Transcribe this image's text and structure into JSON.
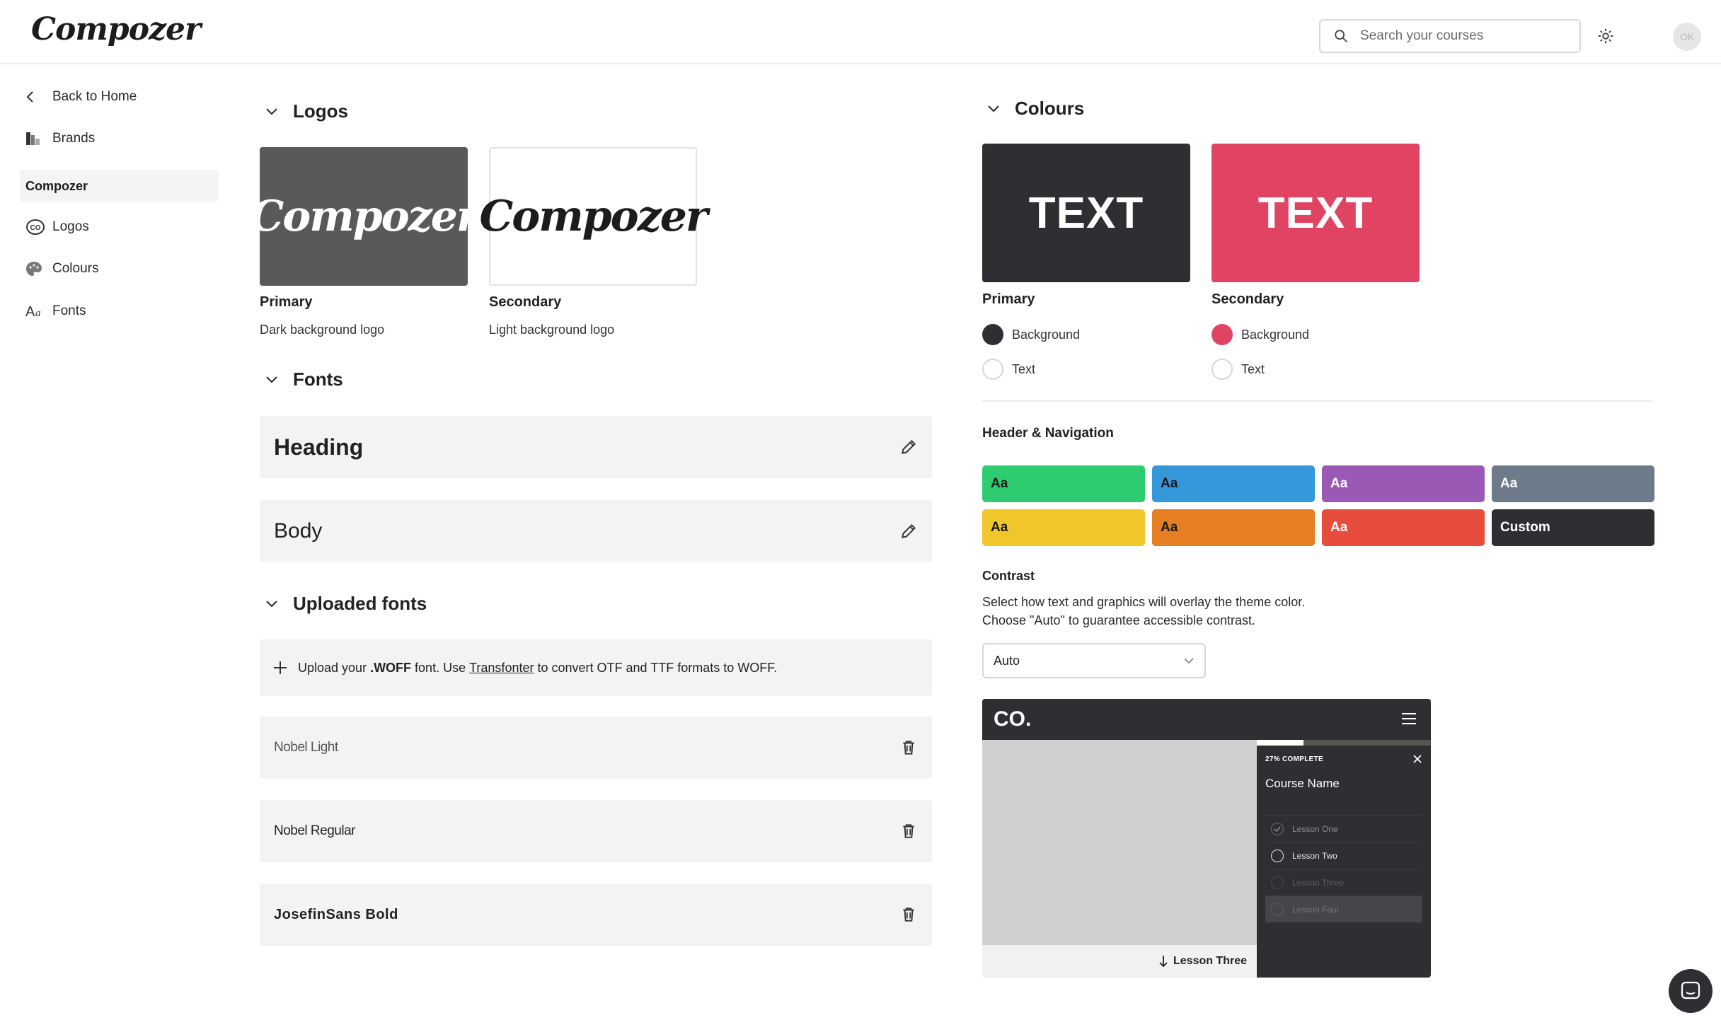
{
  "header": {
    "logo": "Compozer",
    "search_placeholder": "Search your courses",
    "avatar_initials": "OK",
    "icons": {
      "search": "search-icon",
      "settings": "gear-icon"
    }
  },
  "sidebar": {
    "back_label": "Back to Home",
    "brands_label": "Brands",
    "active_brand": "Compozer",
    "items": [
      {
        "label": "Logos",
        "icon": "co-badge-icon"
      },
      {
        "label": "Colours",
        "icon": "palette-icon"
      },
      {
        "label": "Fonts",
        "icon": "font-aa-icon"
      }
    ]
  },
  "logos": {
    "title": "Logos",
    "cards": [
      {
        "logo_text": "Compozer",
        "title": "Primary",
        "subtitle": "Dark background logo"
      },
      {
        "logo_text": "Compozer",
        "title": "Secondary",
        "subtitle": "Light background logo"
      }
    ]
  },
  "fonts": {
    "title": "Fonts",
    "rows": [
      {
        "label": "Heading"
      },
      {
        "label": "Body"
      }
    ]
  },
  "uploaded_fonts": {
    "title": "Uploaded fonts",
    "upload": {
      "prefix": "Upload your ",
      "format": ".WOFF",
      "middle": " font. Use ",
      "link": "Transfonter",
      "suffix": " to convert OTF and TTF formats to WOFF."
    },
    "items": [
      {
        "name": "Nobel Light"
      },
      {
        "name": "Nobel Regular"
      },
      {
        "name": "JosefinSans Bold"
      }
    ]
  },
  "colours": {
    "title": "Colours",
    "swatches": [
      {
        "text": "TEXT",
        "title": "Primary",
        "bg_label": "Background",
        "text_label": "Text",
        "bg_color": "#2e2f33",
        "text_color": "#ffffff"
      },
      {
        "text": "TEXT",
        "title": "Secondary",
        "bg_label": "Background",
        "text_label": "Text",
        "bg_color": "#e04462",
        "text_color": "#ffffff"
      }
    ]
  },
  "header_nav": {
    "title": "Header & Navigation",
    "themes": [
      {
        "label": "Aa",
        "color": "#2ecc71",
        "text": "#1a1a1a"
      },
      {
        "label": "Aa",
        "color": "#3498db",
        "text": "#1a1a1a"
      },
      {
        "label": "Aa",
        "color": "#9b59b6",
        "text": "#ffffff"
      },
      {
        "label": "Aa",
        "color": "#6c7a89",
        "text": "#ffffff"
      },
      {
        "label": "Aa",
        "color": "#f1c62a",
        "text": "#1a1a1a"
      },
      {
        "label": "Aa",
        "color": "#e67e22",
        "text": "#1a1a1a"
      },
      {
        "label": "Aa",
        "color": "#e74c3c",
        "text": "#ffffff"
      },
      {
        "label": "Custom",
        "color": "#2e2f33",
        "text": "#ffffff"
      }
    ]
  },
  "contrast": {
    "title": "Contrast",
    "desc_line1": "Select how text and graphics will overlay the theme color.",
    "desc_line2": "Choose \"Auto\" to guarantee accessible contrast.",
    "selected": "Auto"
  },
  "preview": {
    "brand": "CO.",
    "progress_label": "27% COMPLETE",
    "progress": 0.27,
    "course_name": "Course Name",
    "lessons": [
      {
        "label": "Lesson One",
        "state": "done"
      },
      {
        "label": "Lesson Two",
        "state": "active"
      },
      {
        "label": "Lesson Three",
        "state": "dim"
      },
      {
        "label": "Lesson Four",
        "state": "selected"
      }
    ],
    "footer_label": "Lesson Three"
  }
}
